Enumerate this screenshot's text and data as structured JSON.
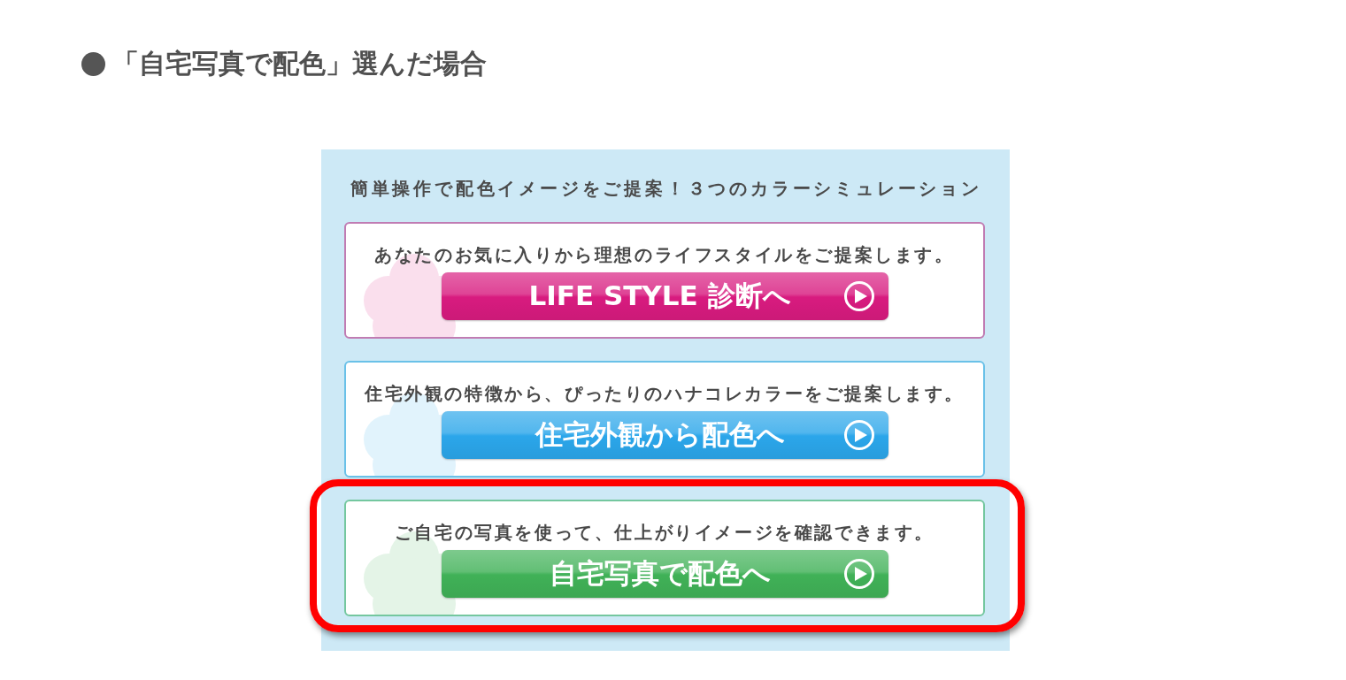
{
  "heading": {
    "text": "「自宅写真で配色」選んだ場合"
  },
  "panel": {
    "title": "簡単操作で配色イメージをご提案！３つのカラーシミュレーション",
    "cards": [
      {
        "description": "あなたのお気に入りから理想のライフスタイルをご提案します。",
        "button": "LIFE STYLE 診断へ",
        "color": "#d81b7f",
        "highlighted": false
      },
      {
        "description": "住宅外観の特徴から、ぴったりのハナコレカラーをご提案します。",
        "button": "住宅外観から配色へ",
        "color": "#2ba6ea",
        "highlighted": false
      },
      {
        "description": "ご自宅の写真を使って、仕上がりイメージを確認できます。",
        "button": "自宅写真で配色へ",
        "color": "#40b157",
        "highlighted": true
      }
    ]
  }
}
